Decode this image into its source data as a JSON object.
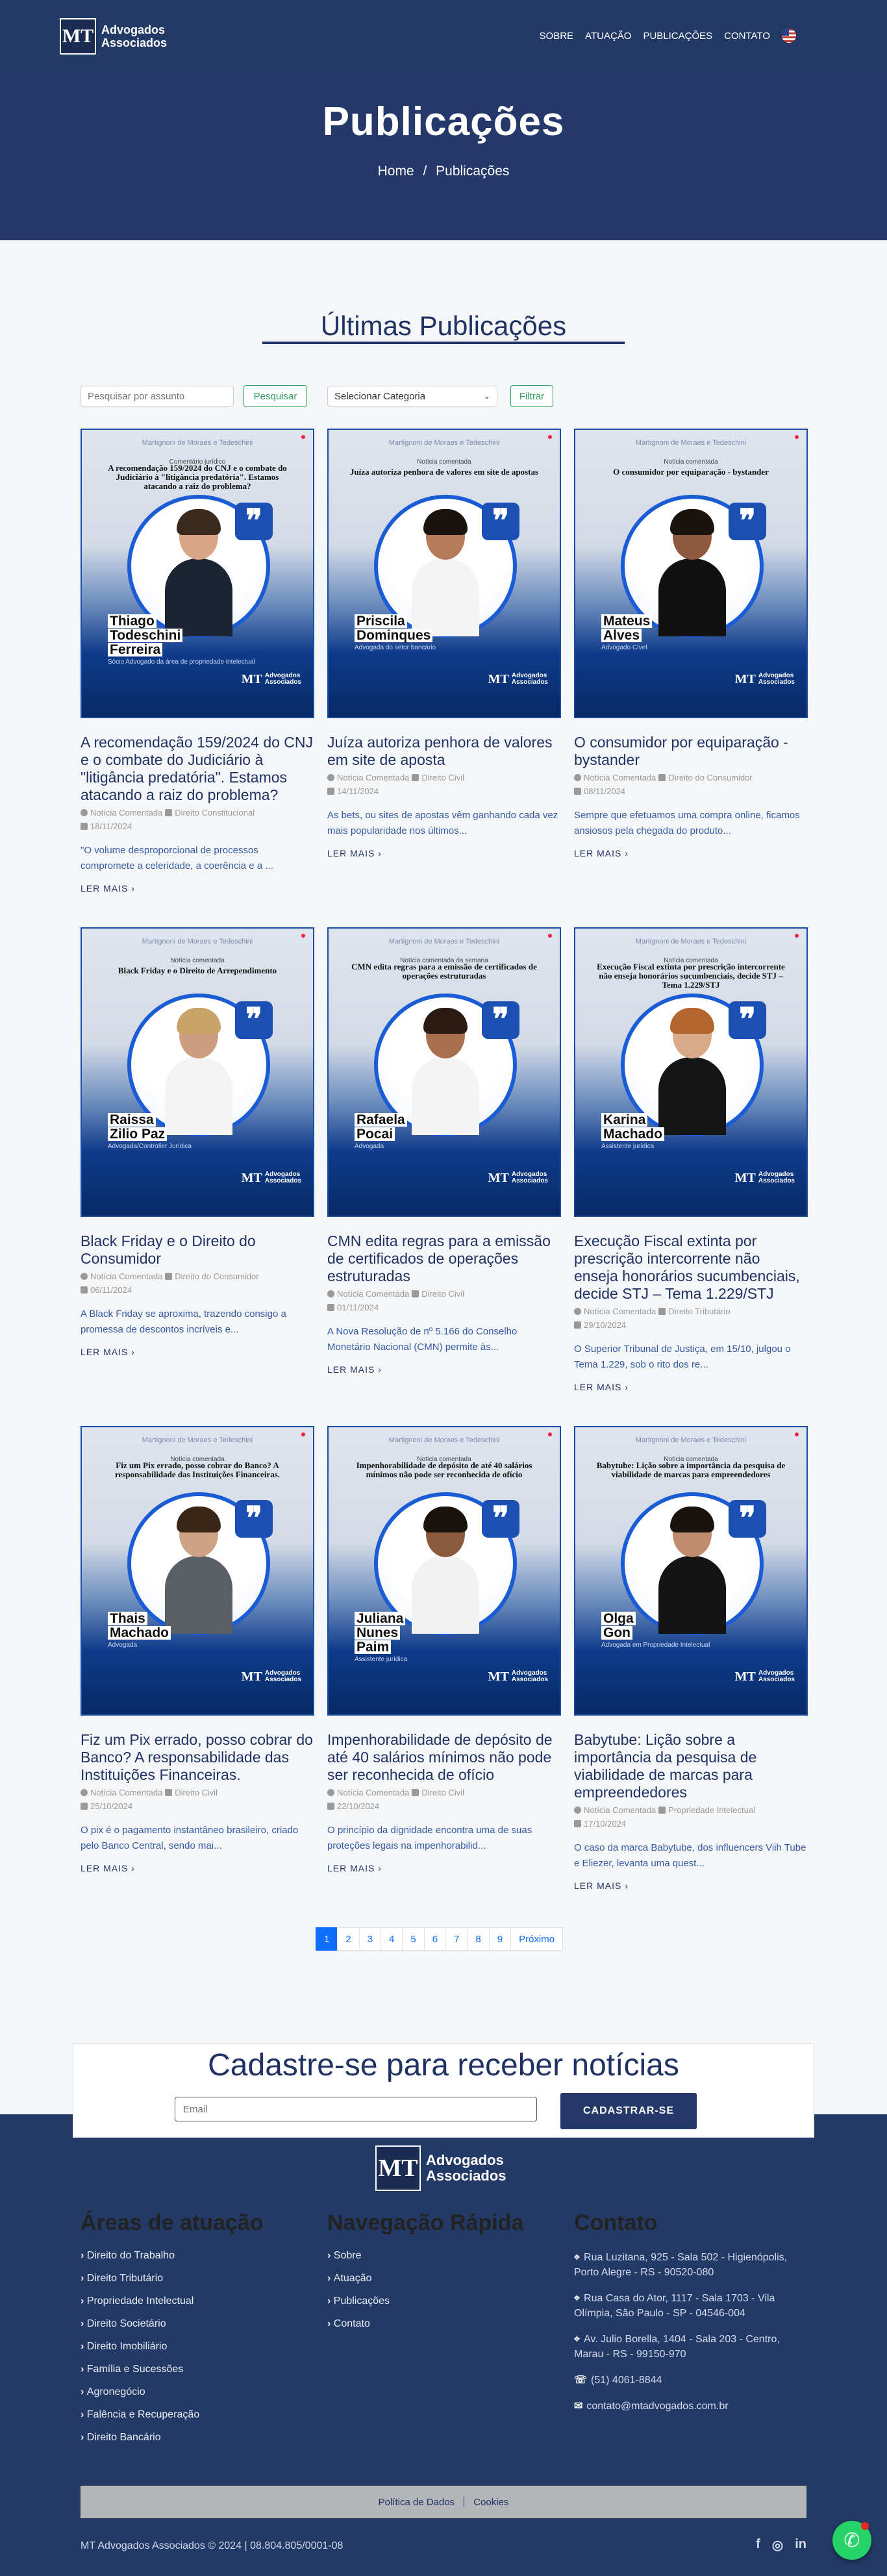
{
  "header": {
    "logo_mark": "MT",
    "logo_line1": "Advogados",
    "logo_line2": "Associados",
    "menu": [
      "SOBRE",
      "ATUAÇÃO",
      "PUBLICAÇÕES",
      "CONTATO"
    ]
  },
  "hero": {
    "title": "Publicações",
    "crumb_home": "Home",
    "crumb_sep": "/",
    "crumb_current": "Publicações"
  },
  "section_title": "Últimas Publicações",
  "filters": {
    "search_placeholder": "Pesquisar por assunto",
    "search_button": "Pesquisar",
    "category_selected": "Selecionar Categoria",
    "filter_button": "Filtrar"
  },
  "image_brand": "Martignoni de Moraes e Tedeschini",
  "posts": [
    {
      "kind": "Comentário jurídico",
      "headline": "A recomendação 159/2024 do CNJ e o combate do Judiciário à \"litigância predatória\". Estamos atacando a raiz do problema?",
      "name": [
        "Thiago",
        "Todeschini",
        "Ferreira"
      ],
      "role": "Sócio Advogado da área de propriedade intelectual",
      "title": "A recomendação 159/2024 do CNJ e o combate do Judiciário à \"litigância predatória\". Estamos atacando a raiz do problema?",
      "type": "Notícia Comentada",
      "category": "Direito Constitucional",
      "date": "18/11/2024",
      "excerpt": "\"O volume desproporcional de processos compromete a celeridade, a coerência e a ...",
      "more": "LER MAIS",
      "hair": "#3a2a1e",
      "skin": "#d8a586",
      "shirt": "#1b2433"
    },
    {
      "kind": "Notícia comentada",
      "headline": "Juíza autoriza penhora de valores em site de apostas",
      "name": [
        "Priscila",
        "Dominques"
      ],
      "role": "Advogada do setor bancário",
      "title": "Juíza autoriza penhora de valores em site de aposta",
      "type": "Notícia Comentada",
      "category": "Direito Civil",
      "date": "14/11/2024",
      "excerpt": "As bets, ou sites de apostas vêm ganhando cada vez mais popularidade nos últimos...",
      "more": "LER MAIS",
      "hair": "#1a120d",
      "skin": "#b57b5b",
      "shirt": "#f4f4f4"
    },
    {
      "kind": "Notícia comentada",
      "headline": "O consumidor por equiparação - bystander",
      "name": [
        "Mateus",
        "Alves"
      ],
      "role": "Advogado Cível",
      "title": "O consumidor por equiparação - bystander",
      "type": "Notícia Comentada",
      "category": "Direito do Consumidor",
      "date": "08/11/2024",
      "excerpt": "Sempre que efetuamos uma compra online, ficamos ansiosos pela chegada do produto...",
      "more": "LER MAIS",
      "hair": "#1a120d",
      "skin": "#8e5a3e",
      "shirt": "#111111"
    },
    {
      "kind": "Notícia comentada",
      "headline": "Black Friday e o Direito de Arrependimento",
      "name": [
        "Raissa",
        "Zilio Paz"
      ],
      "role": "Advogada/Controller Jurídica",
      "title": "Black Friday e o Direito do Consumidor",
      "type": "Notícia Comentada",
      "category": "Direito do Consumidor",
      "date": "06/11/2024",
      "excerpt": "A Black Friday se aproxima, trazendo consigo a promessa de descontos incríveis e...",
      "more": "LER MAIS",
      "hair": "#c9a46a",
      "skin": "#cf9e80",
      "shirt": "#f3f3f3"
    },
    {
      "kind": "Notícia comentada da semana",
      "headline": "CMN edita regras para a emissão de certificados de operações estruturadas",
      "name": [
        "Rafaela",
        "Pocai"
      ],
      "role": "Advogada",
      "title": "CMN edita regras para a emissão de certificados de operações estruturadas",
      "type": "Notícia Comentada",
      "category": "Direito Civil",
      "date": "01/11/2024",
      "excerpt": "A Nova Resolução de nº 5.166 do Conselho Monetário Nacional (CMN) permite às...",
      "more": "LER MAIS",
      "hair": "#2a1a12",
      "skin": "#a8704f",
      "shirt": "#f4f4f4"
    },
    {
      "kind": "Notícia comentada",
      "headline": "Execução Fiscal extinta por prescrição intercorrente não enseja honorários sucumbenciais, decide STJ – Tema 1.229/STJ",
      "name": [
        "Karina",
        "Machado"
      ],
      "role": "Assistente jurídica",
      "title": "Execução Fiscal extinta por prescrição intercorrente não enseja honorários sucumbenciais, decide STJ – Tema 1.229/STJ",
      "type": "Notícia Comentada",
      "category": "Direito Tributário",
      "date": "29/10/2024",
      "excerpt": "O Superior Tribunal de Justiça, em 15/10, julgou o Tema 1.229, sob o rito dos re...",
      "more": "LER MAIS",
      "hair": "#b5652e",
      "skin": "#d9a98a",
      "shirt": "#151515"
    },
    {
      "kind": "Notícia comentada",
      "headline": "Fiz um Pix errado, posso cobrar do Banco? A responsabilidade das Instituições Financeiras.",
      "name": [
        "Thais",
        "Machado"
      ],
      "role": "Advogada",
      "title": "Fiz um Pix errado, posso cobrar do Banco? A responsabilidade das Instituições Financeiras.",
      "type": "Notícia Comentada",
      "category": "Direito Civil",
      "date": "25/10/2024",
      "excerpt": "O pix é o pagamento instantâneo brasileiro, criado pelo Banco Central, sendo mai...",
      "more": "LER MAIS",
      "hair": "#3a2616",
      "skin": "#d0a284",
      "shirt": "#5a5f66"
    },
    {
      "kind": "Notícia comentada",
      "headline": "Impenhorabilidade de depósito de até 40 salários mínimos não pode ser reconhecida de ofício",
      "name": [
        "Juliana",
        "Nunes",
        "Paim"
      ],
      "role": "Assistente jurídica",
      "title": "Impenhorabilidade de depósito de até 40 salários mínimos não pode ser reconhecida de ofício",
      "type": "Notícia Comentada",
      "category": "Direito Civil",
      "date": "22/10/2024",
      "excerpt": "O princípio da dignidade encontra uma de suas proteções legais na impenhorabilid...",
      "more": "LER MAIS",
      "hair": "#1a120d",
      "skin": "#8a5a3e",
      "shirt": "#f2f2f2"
    },
    {
      "kind": "Notícia comentada",
      "headline": "Babytube: Lição sobre a importância da pesquisa de viabilidade de marcas para empreendedores",
      "name": [
        "Olga",
        "Gon"
      ],
      "role": "Advogada em Propriedade Intelectual",
      "title": "Babytube: Lição sobre a importância da pesquisa de viabilidade de marcas para empreendedores",
      "type": "Notícia Comentada",
      "category": "Propriedade Intelectual",
      "date": "17/10/2024",
      "excerpt": "O caso da marca Babytube, dos influencers Viih Tube e Eliezer, levanta uma quest...",
      "more": "LER MAIS",
      "hair": "#1a120d",
      "skin": "#c08c6c",
      "shirt": "#141414"
    }
  ],
  "pagination": {
    "pages": [
      "1",
      "2",
      "3",
      "4",
      "5",
      "6",
      "7",
      "8",
      "9"
    ],
    "next": "Próximo",
    "active": 1
  },
  "newsletter": {
    "title": "Cadastre-se para receber notícias",
    "email_placeholder": "Email",
    "button": "CADASTRAR-SE"
  },
  "footer": {
    "areas_title": "Áreas de atuação",
    "areas": [
      "Direito do Trabalho",
      "Direito Tributário",
      "Propriedade Intelectual",
      "Direito Societário",
      "Direito Imobiliário",
      "Família e Sucessões",
      "Agronegócio",
      "Falência e Recuperação",
      "Direito Bancário"
    ],
    "nav_title": "Navegação Rápida",
    "nav": [
      "Sobre",
      "Atuação",
      "Publicações",
      "Contato"
    ],
    "contact_title": "Contato",
    "addresses": [
      "Rua Luzitana, 925 - Sala 502 - Higienópolis, Porto Alegre - RS - 90520-080",
      "Rua Casa do Ator, 1117 - Sala 1703 - Vila Olímpia, São Paulo - SP - 04546-004",
      "Av. Julio Borella, 1404 - Sala 203 - Centro, Marau - RS - 99150-970"
    ],
    "phone": "(51) 4061-8844",
    "email": "contato@mtadvogados.com.br",
    "policy": "Política de Dados",
    "cookies": "Cookies",
    "copyright": "MT Advogados Associados © 2024 | 08.804.805/0001-08"
  }
}
